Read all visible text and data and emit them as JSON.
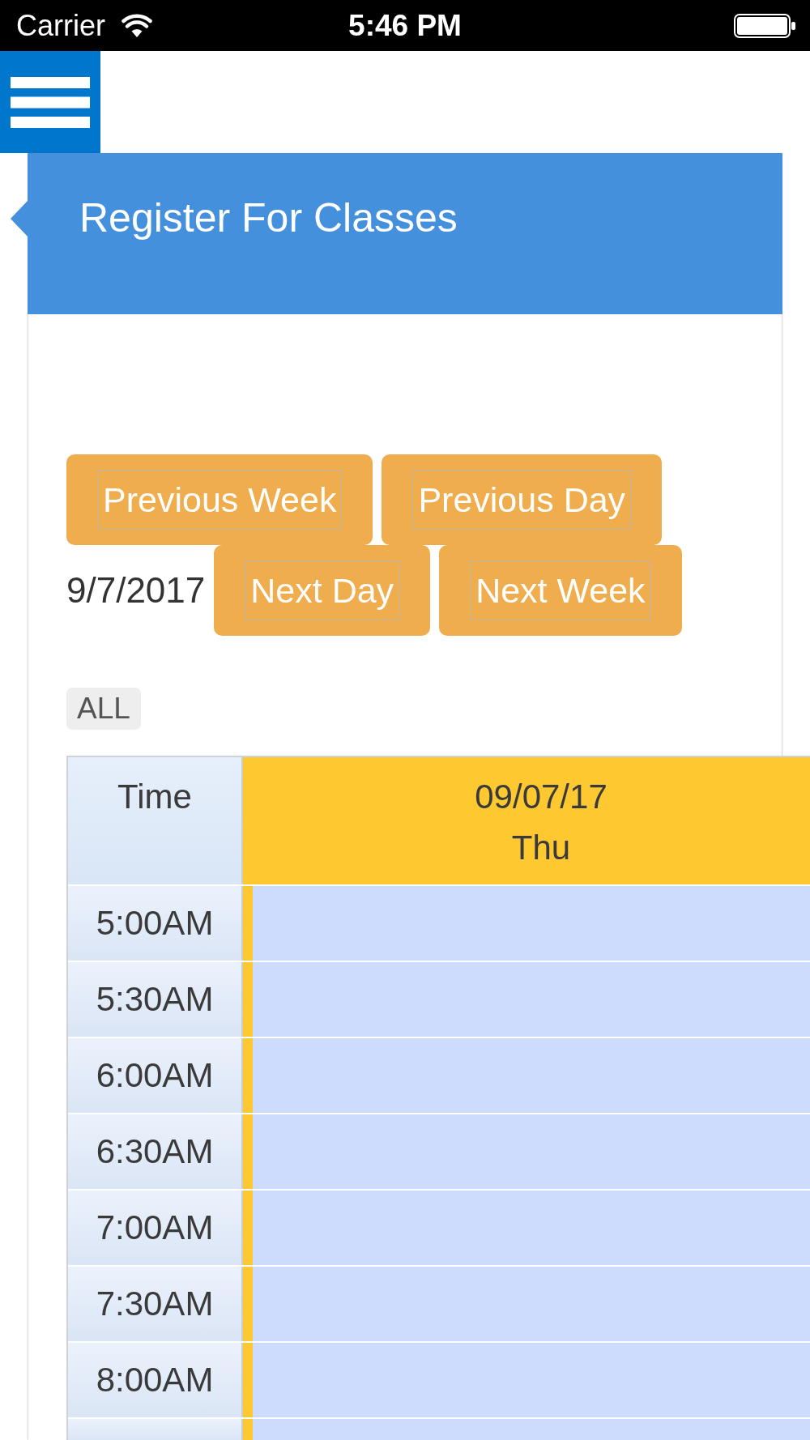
{
  "status_bar": {
    "carrier": "Carrier",
    "time": "5:46 PM"
  },
  "page": {
    "title": "Register For Classes"
  },
  "date_nav": [
    {
      "kind": "button",
      "label": "Previous Week"
    },
    {
      "kind": "button",
      "label": "Previous Day"
    },
    {
      "kind": "date",
      "label": "9/7/2017"
    },
    {
      "kind": "button",
      "label": "Next Day"
    },
    {
      "kind": "button",
      "label": "Next Week"
    }
  ],
  "filters": [
    {
      "label": "ALL"
    }
  ],
  "schedule": {
    "time_header": "Time",
    "day": {
      "date": "09/07/17",
      "weekday": "Thu"
    },
    "rows": [
      {
        "time": "5:00AM"
      },
      {
        "time": "5:30AM"
      },
      {
        "time": "6:00AM"
      },
      {
        "time": "6:30AM"
      },
      {
        "time": "7:00AM"
      },
      {
        "time": "7:30AM"
      },
      {
        "time": "8:00AM"
      }
    ]
  }
}
